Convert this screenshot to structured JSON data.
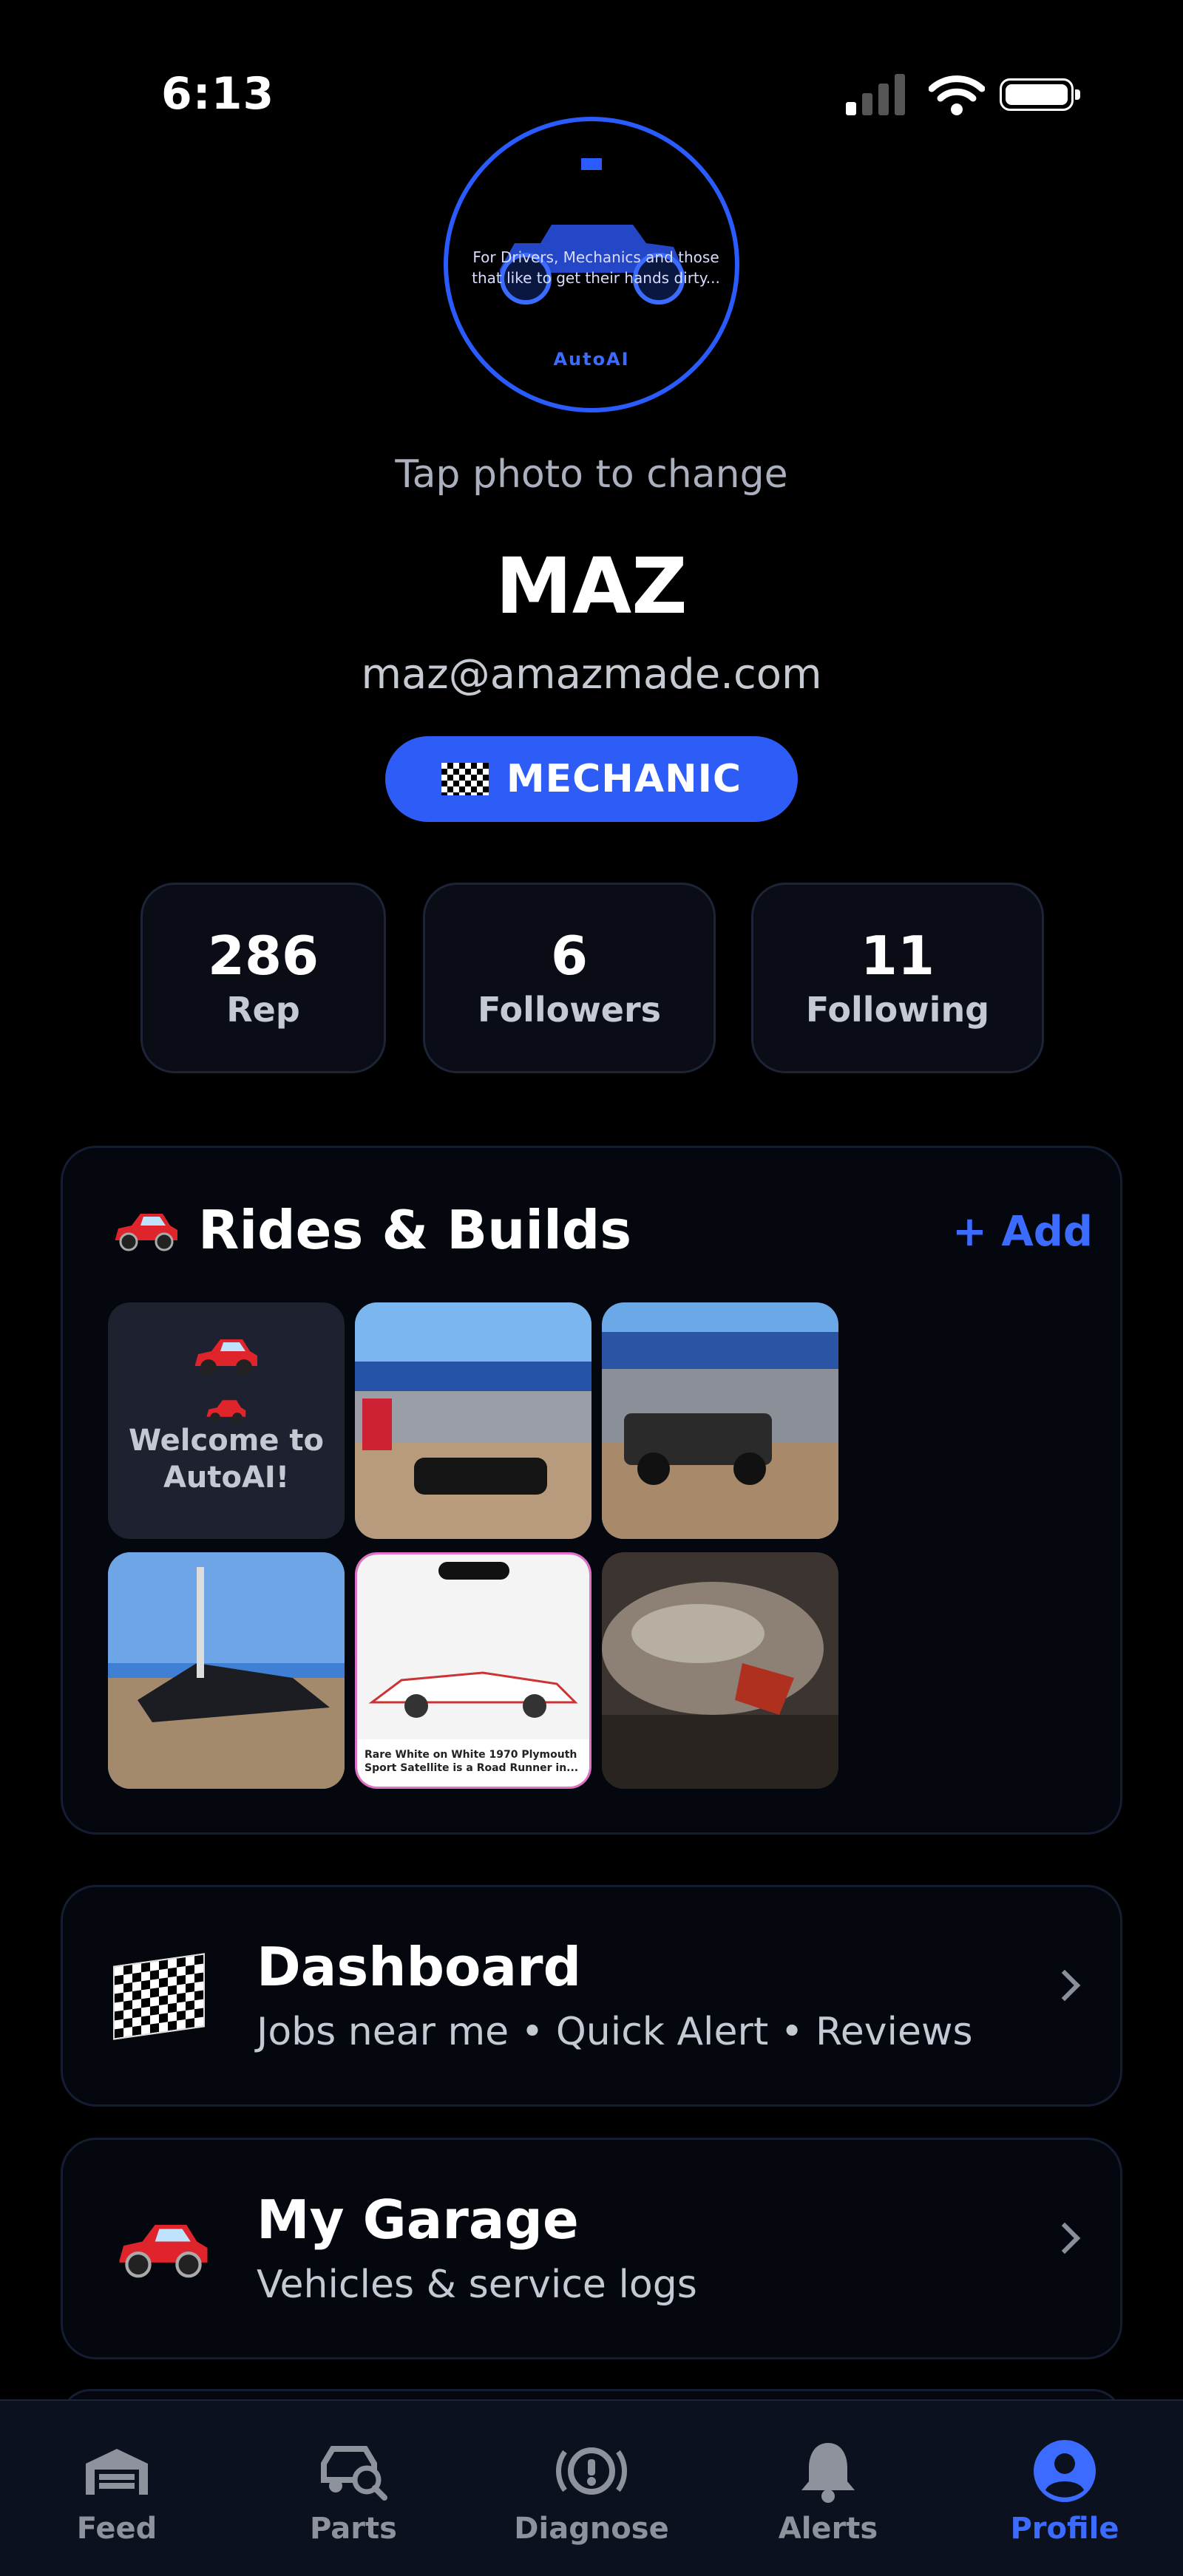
{
  "status_bar": {
    "time": "6:13"
  },
  "profile": {
    "avatar_logo_text": "AutoAI",
    "avatar_tagline": "For Drivers, Mechanics and those that like to get their hands dirty...",
    "tap_to_change": "Tap photo to change",
    "name": "MAZ",
    "email": "maz@amazmade.com",
    "role": "MECHANIC"
  },
  "stats": [
    {
      "value": "286",
      "label": "Rep"
    },
    {
      "value": "6",
      "label": "Followers"
    },
    {
      "value": "11",
      "label": "Following"
    }
  ],
  "rides": {
    "title": "Rides & Builds",
    "add_label": "+ Add",
    "welcome_text": "Welcome to AutoAI!",
    "photo_caption": "Rare White on White 1970 Plymouth Sport Satellite is a Road Runner in..."
  },
  "menu": [
    {
      "title": "Dashboard",
      "subtitle": "Jobs near me • Quick Alert • Reviews",
      "icon": "checkered-flag-icon"
    },
    {
      "title": "My Garage",
      "subtitle": "Vehicles & service logs",
      "icon": "red-car-icon"
    }
  ],
  "tabs": [
    {
      "label": "Feed",
      "icon": "garage-icon"
    },
    {
      "label": "Parts",
      "icon": "car-search-icon"
    },
    {
      "label": "Diagnose",
      "icon": "alert-circle-icon"
    },
    {
      "label": "Alerts",
      "icon": "bell-icon"
    },
    {
      "label": "Profile",
      "icon": "person-icon",
      "active": true
    }
  ],
  "colors": {
    "accent": "#2e5cf6",
    "background": "#000000",
    "card_border": "#151d33",
    "tab_bar": "#0c1120"
  }
}
